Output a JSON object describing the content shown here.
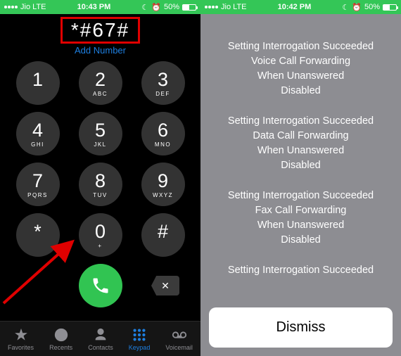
{
  "left": {
    "status": {
      "carrier": "Jio  LTE",
      "time": "10:43 PM",
      "battery": "50%"
    },
    "entered_number": "*#67#",
    "add_number_label": "Add Number",
    "keys": [
      {
        "digit": "1",
        "letters": ""
      },
      {
        "digit": "2",
        "letters": "ABC"
      },
      {
        "digit": "3",
        "letters": "DEF"
      },
      {
        "digit": "4",
        "letters": "GHI"
      },
      {
        "digit": "5",
        "letters": "JKL"
      },
      {
        "digit": "6",
        "letters": "MNO"
      },
      {
        "digit": "7",
        "letters": "PQRS"
      },
      {
        "digit": "8",
        "letters": "TUV"
      },
      {
        "digit": "9",
        "letters": "WXYZ"
      },
      {
        "digit": "*",
        "letters": ""
      },
      {
        "digit": "0",
        "letters": "+"
      },
      {
        "digit": "#",
        "letters": ""
      }
    ],
    "delete_glyph": "✕",
    "tabs": [
      {
        "id": "favorites",
        "label": "Favorites"
      },
      {
        "id": "recents",
        "label": "Recents"
      },
      {
        "id": "contacts",
        "label": "Contacts"
      },
      {
        "id": "keypad",
        "label": "Keypad"
      },
      {
        "id": "voicemail",
        "label": "Voicemail"
      }
    ]
  },
  "right": {
    "status": {
      "carrier": "Jio  LTE",
      "time": "10:42 PM",
      "battery": "50%"
    },
    "blocks": [
      [
        "Setting Interrogation Succeeded",
        "Voice Call Forwarding",
        "When Unanswered",
        "Disabled"
      ],
      [
        "Setting Interrogation Succeeded",
        "Data Call Forwarding",
        "When Unanswered",
        "Disabled"
      ],
      [
        "Setting Interrogation Succeeded",
        "Fax Call Forwarding",
        "When Unanswered",
        "Disabled"
      ]
    ],
    "partial_line": "Setting Interrogation Succeeded",
    "dismiss_label": "Dismiss"
  }
}
